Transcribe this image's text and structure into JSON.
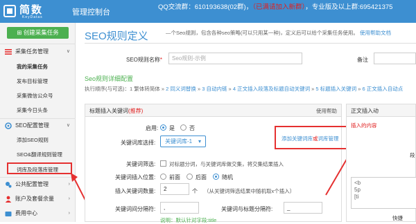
{
  "app": {
    "logo_text": "简数",
    "logo_sub": "KeyDatas",
    "console_title": "管理控制台",
    "top_info_prefix": "QQ交流群：610193638(02群)，",
    "top_info_red": "（已满请加入新群）",
    "top_info_suffix": "，专业版及以上群:695421375",
    "colors": {
      "topbar": "#3d8fd1",
      "accent_green": "#4cb050",
      "highlight_red": "#e53030"
    }
  },
  "sidebar": {
    "create_button": "创建采集任务",
    "groups": [
      {
        "label": "采集任务管理",
        "icon": "list-icon",
        "items": [
          "我的采集任务",
          "发布目标管理",
          "采集微信公众号",
          "采集今日头条"
        ]
      },
      {
        "label": "SEO配置管理",
        "icon": "gear-icon",
        "items": [
          "添加SEO规则",
          "SEO&翻译规则管理",
          "词库及段落库管理"
        ]
      },
      {
        "label": "公共配置管理",
        "icon": "cogs-icon",
        "items": []
      },
      {
        "label": "账户及套餐余量",
        "icon": "user-icon",
        "items": []
      },
      {
        "label": "费用中心",
        "icon": "wallet-icon",
        "items": []
      }
    ],
    "active_item": "我的采集任务",
    "highlighted_item": "词库及段落库管理"
  },
  "main": {
    "title": "SEO规则定义",
    "desc_prefix": "—个Seo规则，包含各种seo策略(可以只用某一种)，定义后可以给个采集任务使用。",
    "help_link": "使用帮助文档",
    "rule_name_label": "SEO规则名称",
    "rule_name_placeholder": "Seo规则-示例",
    "note_label": "备注",
    "section_title": "Seo规则详细配置",
    "flow_prefix": "执行顺序(与可选)：1 繁体转简体 » ",
    "flow_steps": [
      "2 同义词替换",
      "3 自动内链",
      "4 正文插入段落及标题自动关键词",
      "5 标题插入关键词",
      "6 正文插入自动点"
    ],
    "panel": {
      "title": "标题插入关键词",
      "title_tag": "(推荐)",
      "help": "使用帮助",
      "enable_label": "启用:",
      "enable_yes": "是",
      "enable_no": "否",
      "lexicon_label": "关键词库选择:",
      "lexicon_value": "关键词库-1",
      "filter_label": "关键词筛选:",
      "filter_text": "对标题分词，与关键词库做交集，将交集结果插入",
      "position_label": "关键词插入位置:",
      "position_options": [
        "前面",
        "后面",
        "随机"
      ],
      "count_label": "插入关键词数量:",
      "count_value": "2",
      "count_unit": "个",
      "count_hint": "（从关键词筛选结果中随机取x个插入）",
      "sep_label": "关键词间分隔符:",
      "sep_value": ",",
      "title_sep_label": "关键词与标题分隔符:",
      "title_sep_value": "_",
      "note": "说明：默认针对字段:title",
      "manage_link_prefix": "添加关键词库",
      "manage_link_or": "或",
      "manage_link_suffix": "词库管理"
    },
    "right_panel": {
      "title": "正文插入动",
      "line1": "插入的内容",
      "line2": "段",
      "code1": "<b",
      "code2": "5p",
      "code3": "[ti",
      "footer": "快捷"
    }
  }
}
